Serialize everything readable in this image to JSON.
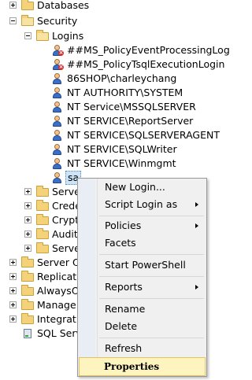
{
  "tree": {
    "databases": "Databases",
    "security": "Security",
    "logins": "Logins",
    "login_items": [
      "##MS_PolicyEventProcessingLog",
      "##MS_PolicyTsqlExecutionLogin",
      "86SHOP\\charleychang",
      "NT AUTHORITY\\SYSTEM",
      "NT Service\\MSSQLSERVER",
      "NT SERVICE\\ReportServer",
      "NT SERVICE\\SQLSERVERAGENT",
      "NT SERVICE\\SQLWriter",
      "NT SERVICE\\Winmgmt",
      "sa"
    ],
    "security_children_partial": [
      "Serve",
      "Crede",
      "Crypt",
      "Audit",
      "Serve"
    ],
    "root_partial": [
      "Server O",
      "Replicatio",
      "AlwaysO",
      "Manage",
      "Integratio",
      "SQL Serv"
    ]
  },
  "context_menu": {
    "items": [
      "New Login...",
      "Script Login as",
      "Policies",
      "Facets",
      "Start PowerShell",
      "Reports",
      "Rename",
      "Delete",
      "Refresh",
      "Properties"
    ]
  }
}
